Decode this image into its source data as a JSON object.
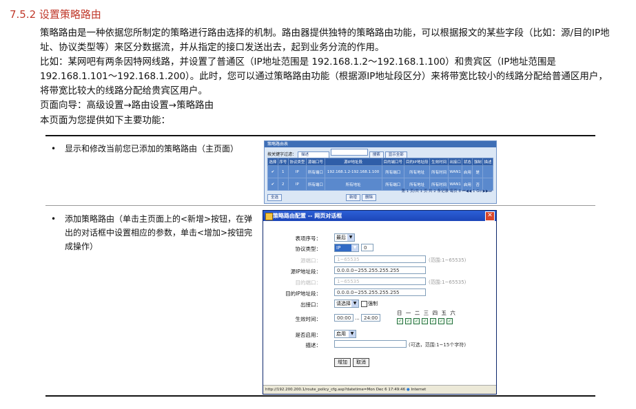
{
  "heading": "7.5.2  设置策略路由",
  "paragraphs": [
    "策略路由是一种依据您所制定的策略进行路由选择的机制。路由器提供独特的策略路由功能，可以根据报文的某些字段（比如：源/目的IP地址、协议类型等）来区分数据流，并从指定的接口发送出去，起到业务分流的作用。",
    "比如：某网吧有两条因特网线路，并设置了普通区（IP地址范围是 192.168.1.2～192.168.1.100）和贵宾区（IP地址范围是 192.168.1.101～192.168.1.200）。此时，您可以通过策略路由功能（根据源IP地址段区分）来将带宽比较小的线路分配给普通区用户，将带宽比较大的线路分配给贵宾区用户。",
    "页面向导：高级设置→路由设置→策略路由",
    "本页面为您提供如下主要功能："
  ],
  "features": [
    "显示和修改当前您已添加的策略路由（主页面）",
    "添加策略路由（单击主页面上的<新增>按钮，在弹出的对话框中设置相应的参数，单击<增加>按钮完成操作）"
  ],
  "shot1": {
    "title": "策略路由表",
    "filter_label": "按关键字过滤：",
    "filter_value": "描述",
    "btn_search": "搜索",
    "btn_showall": "显示全部",
    "columns": [
      "选择",
      "序号",
      "协议类型",
      "源端口号",
      "源IP地址段",
      "目的端口号",
      "目的IP地址段",
      "生效时间",
      "出接口",
      "状态",
      "强制",
      "描述"
    ],
    "rows": [
      [
        "✔",
        "1",
        "IP",
        "所有端口",
        "192.168.1.2-192.168.1.100",
        "所有端口",
        "所有地址",
        "所有时间",
        "WAN1",
        "启用",
        "是",
        ""
      ],
      [
        "✔",
        "2",
        "IP",
        "所有端口",
        "所有地址",
        "所有端口",
        "所有地址",
        "所有时间",
        "WAN1",
        "启用",
        "否",
        ""
      ]
    ],
    "pager": "第 1 页/共 1 页 共 2 条记录 每页 8 ⏮◀◀ 1 Go ▶▶⏭",
    "btn_all": "全选",
    "btn_add": "新增",
    "btn_delete": "删除"
  },
  "dialog": {
    "title": "策略路由配置 -- 网页对话框",
    "fields": {
      "order_label": "表项序号：",
      "order_value": "最后",
      "proto_label": "协议类型：",
      "proto_value": "IP",
      "proto_num": "0",
      "sport_label": "源端口：",
      "sport_value": "1~65535",
      "sport_hint": "(范围:1~65535)",
      "sip_label": "源IP地址段：",
      "sip_value": "0.0.0.0~255.255.255.255",
      "dport_label": "目的端口：",
      "dport_value": "1~65535",
      "dport_hint": "(范围:1~65535)",
      "dip_label": "目的IP地址段：",
      "dip_value": "0.0.0.0~255.255.255.255",
      "iface_label": "出接口：",
      "iface_value": "请选择",
      "force_label": "强制",
      "time_label": "生效时间：",
      "time_from": "00:00",
      "time_sep": "...",
      "time_to": "24:00",
      "days": [
        "日",
        "一",
        "二",
        "三",
        "四",
        "五",
        "六"
      ],
      "enable_label": "是否启用：",
      "enable_value": "启用",
      "desc_label": "描述：",
      "desc_hint": "(可选，范围:1~15个字符)"
    },
    "btn_add": "增加",
    "btn_cancel": "取消",
    "status": "http://192.200.200.1/route_policy_cfg.asp?datetime=Mon Dec 6 17:49:46",
    "zone": "Internet"
  }
}
